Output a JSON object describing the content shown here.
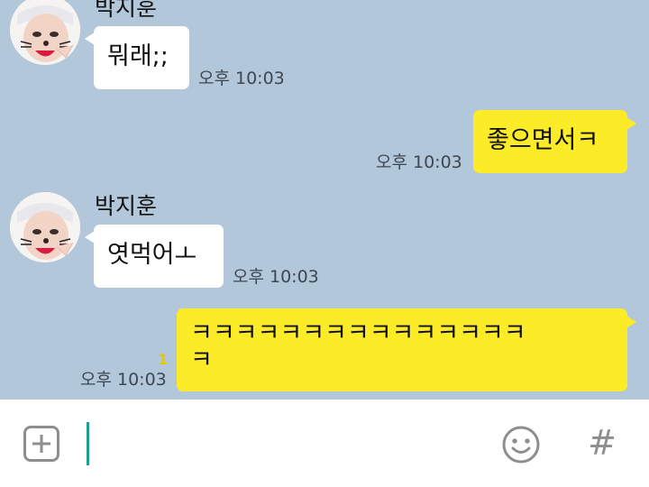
{
  "messages": [
    {
      "sender": "박지훈",
      "text": "뭐래;;",
      "time": "오후 10:03"
    },
    {
      "text": "좋으면서ㅋ",
      "time": "오후 10:03"
    },
    {
      "sender": "박지훈",
      "text": "엿먹어ㅗ",
      "time": "오후 10:03"
    },
    {
      "text_line1": "ㅋㅋㅋㅋㅋㅋㅋㅋㅋㅋㅋㅋㅋㅋㅋ",
      "text_line2": "ㅋ",
      "time": "오후 10:03",
      "unread": "1"
    }
  ],
  "input": {
    "value": "",
    "icons": [
      "add-icon",
      "emoji-icon",
      "hashtag-icon"
    ],
    "hash_glyph": "#"
  },
  "colors": {
    "background": "#b2c7d9",
    "incoming_bubble": "#ffffff",
    "outgoing_bubble": "#fbec27",
    "cursor": "#1ea08f"
  }
}
